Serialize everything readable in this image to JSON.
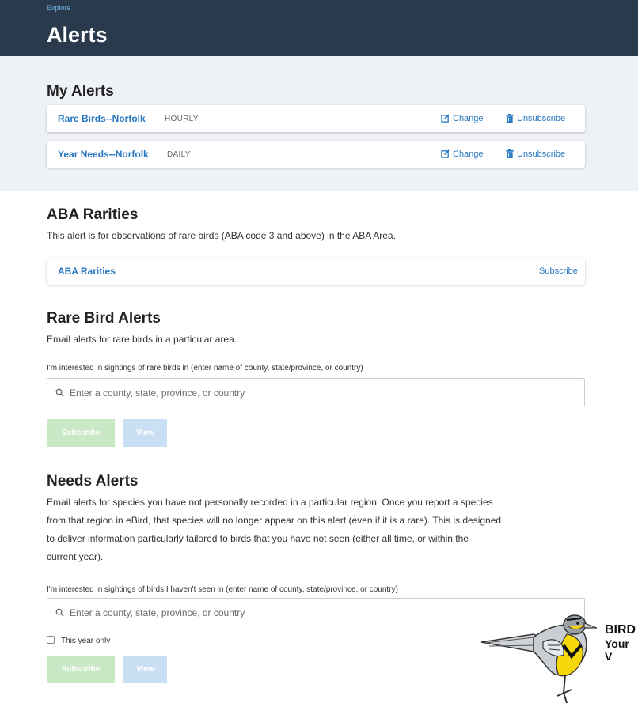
{
  "header": {
    "breadcrumb": "Explore",
    "title": "Alerts"
  },
  "my_alerts": {
    "title": "My Alerts",
    "items": [
      {
        "name": "Rare Birds--Norfolk",
        "frequency": "HOURLY",
        "change_label": "Change",
        "unsubscribe_label": "Unsubscribe"
      },
      {
        "name": "Year Needs--Norfolk",
        "frequency": "DAILY",
        "change_label": "Change",
        "unsubscribe_label": "Unsubscribe"
      }
    ]
  },
  "aba": {
    "title": "ABA Rarities",
    "description": "This alert is for observations of rare birds (ABA code 3 and above) in the ABA Area.",
    "item_name": "ABA Rarities",
    "subscribe_label": "Subscribe"
  },
  "rare_bird": {
    "title": "Rare Bird Alerts",
    "description": "Email alerts for rare birds in a particular area.",
    "field_label": "I'm interested in sightings of rare birds in (enter name of county, state/province, or country)",
    "placeholder": "Enter a county, state, province, or country",
    "subscribe_label": "Subscribe",
    "view_label": "View"
  },
  "needs": {
    "title": "Needs Alerts",
    "description_lines": [
      "Email alerts for species you have not personally recorded in a particular region. Once you report a species",
      "from that region in eBird, that species will no longer appear on this alert (even if it is a rare). This is designed",
      "to deliver information particularly tailored to birds that you have not seen (either all time, or within the",
      "current year)."
    ],
    "field_label": "I'm interested in sightings of birds I haven't seen in (enter name of county, state/province, or country)",
    "placeholder": "Enter a county, state, province, or country",
    "checkbox_label": "This year only",
    "checkbox_checked": false,
    "subscribe_label": "Subscribe",
    "view_label": "View"
  },
  "logo": {
    "line1": "BIRD",
    "line2": "Your V"
  },
  "colors": {
    "header_bg": "#283a4c",
    "link": "#2777c0",
    "panel_bg": "#eef2f7",
    "subscribe_disabled": "#c9e8c6",
    "view_disabled": "#cadff4"
  },
  "icons": {
    "change": "edit-icon",
    "unsubscribe": "trash-icon",
    "search": "search-icon"
  }
}
